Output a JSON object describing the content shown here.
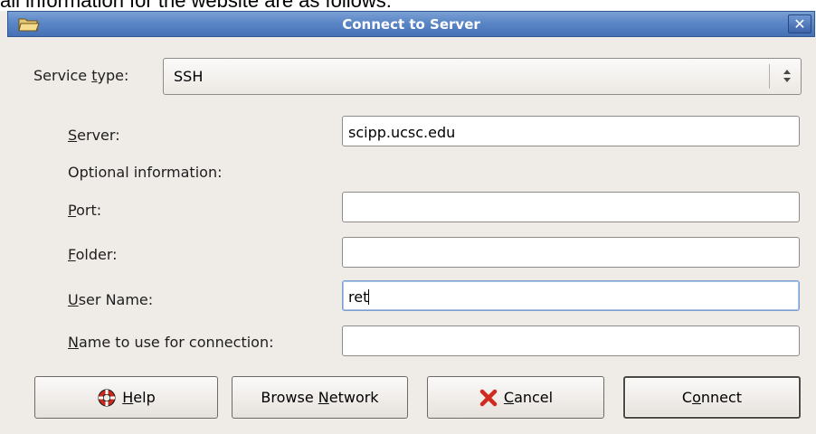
{
  "context_text": "all information for the website are as follows:",
  "window": {
    "title": "Connect to Server",
    "close_glyph": "✕",
    "icons": {
      "window": "folder-icon",
      "close": "close-icon"
    }
  },
  "service_type": {
    "label_pre": "Service ",
    "label_mnemonic": "t",
    "label_post": "ype:",
    "selected": "SSH",
    "icon": "spin-arrows-icon"
  },
  "fields": {
    "server": {
      "mnemonic": "S",
      "label_rest": "erver:",
      "value": "scipp.ucsc.edu"
    },
    "optional_heading": "Optional information:",
    "port": {
      "mnemonic": "P",
      "label_rest": "ort:",
      "value": ""
    },
    "folder": {
      "mnemonic": "F",
      "label_rest": "older:",
      "value": ""
    },
    "user": {
      "mnemonic": "U",
      "label_rest": "ser Name:",
      "value": "ret"
    },
    "name_to_use": {
      "mnemonic": "N",
      "label_rest": "ame to use for connection:",
      "value": ""
    }
  },
  "buttons": {
    "help": {
      "mnemonic": "H",
      "rest": "elp",
      "icon": "lifebuoy-icon"
    },
    "browse": {
      "pre": "Browse ",
      "mnemonic": "N",
      "rest": "etwork"
    },
    "cancel": {
      "mnemonic": "C",
      "rest": "ancel",
      "icon": "red-x-icon"
    },
    "connect": {
      "pre": "C",
      "mnemonic": "o",
      "rest": "nnect"
    }
  },
  "colors": {
    "titlebar": "#5b86c6",
    "dialog_bg": "#efebe7",
    "cancel_icon": "#d12b1f",
    "help_icon": "#cc2a1d"
  }
}
